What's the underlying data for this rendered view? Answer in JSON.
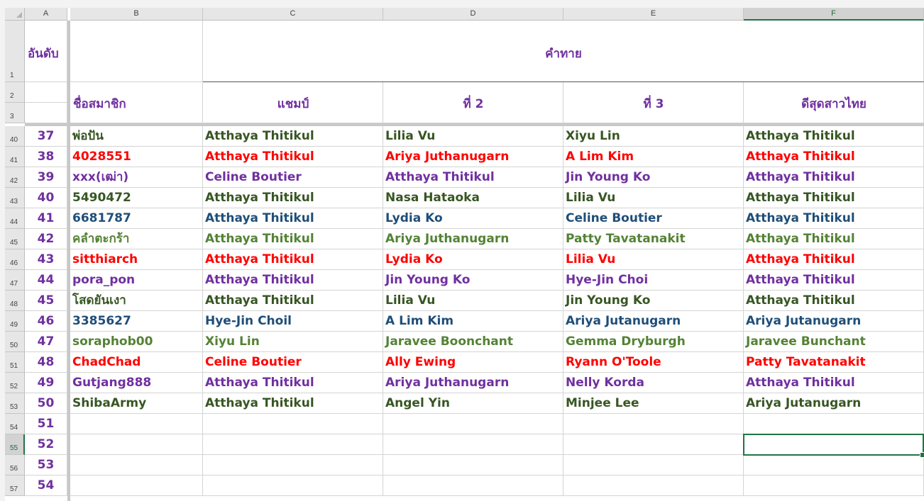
{
  "columns": [
    "A",
    "B",
    "C",
    "D",
    "E",
    "F"
  ],
  "selected_column": "F",
  "selected_cell": "F55",
  "header": {
    "rank": "อันดับ",
    "member": "ชื่อสมาชิก",
    "predictions": "คำทาย",
    "champion": "แชมป์",
    "second": "ที่ 2",
    "third": "ที่ 3",
    "best_thai": "ดีสุดสาวไทย"
  },
  "header_rows": [
    "1",
    "2",
    "3"
  ],
  "colors": {
    "purple": "#7030a0",
    "dark_green": "#375623",
    "red": "#ff0000",
    "blue": "#1f4e79",
    "green": "#548235",
    "selection": "#217346"
  },
  "rows": [
    {
      "row": "40",
      "rank": "37",
      "member": "พ่อปัน",
      "champion": "Atthaya Thitikul",
      "second": "Lilia Vu",
      "third": "Xiyu Lin",
      "best_thai": "Atthaya Thitikul",
      "color": "#375623"
    },
    {
      "row": "41",
      "rank": "38",
      "member": "4028551",
      "champion": "Atthaya Thitikul",
      "second": "Ariya Juthanugarn",
      "third": "A Lim Kim",
      "best_thai": "Atthaya Thitikul",
      "color": "#ff0000"
    },
    {
      "row": "42",
      "rank": "39",
      "member": "xxx(เฒ่า)",
      "champion": "Celine Boutier",
      "second": "Atthaya Thitikul",
      "third": "Jin Young Ko",
      "best_thai": "Atthaya Thitikul",
      "color": "#7030a0"
    },
    {
      "row": "43",
      "rank": "40",
      "member": "5490472",
      "champion": "Atthaya Thitikul",
      "second": "Nasa Hataoka",
      "third": "Lilia Vu",
      "best_thai": "Atthaya Thitikul",
      "color": "#375623"
    },
    {
      "row": "44",
      "rank": "41",
      "member": "6681787",
      "champion": "Atthaya Thitikul",
      "second": "Lydia Ko",
      "third": "Celine Boutier",
      "best_thai": "Atthaya Thitikul",
      "color": "#1f4e79"
    },
    {
      "row": "45",
      "rank": "42",
      "member": "คลำตะกร้า",
      "champion": "Atthaya Thitikul",
      "second": "Ariya Juthanugarn",
      "third": "Patty Tavatanakit",
      "best_thai": "Atthaya Thitikul",
      "color": "#548235"
    },
    {
      "row": "46",
      "rank": "43",
      "member": "sitthiarch",
      "champion": "Atthaya Thitikul",
      "second": "Lydia Ko",
      "third": "Lilia Vu",
      "best_thai": "Atthaya Thitikul",
      "color": "#ff0000"
    },
    {
      "row": "47",
      "rank": "44",
      "member": "pora_pon",
      "champion": "Atthaya Thitikul",
      "second": "Jin Young Ko",
      "third": "Hye-Jin Choi",
      "best_thai": "Atthaya Thitikul",
      "color": "#7030a0"
    },
    {
      "row": "48",
      "rank": "45",
      "member": "โสดยันเงา",
      "champion": "Atthaya Thitikul",
      "second": "Lilia Vu",
      "third": "Jin Young Ko",
      "best_thai": "Atthaya Thitikul",
      "color": "#375623"
    },
    {
      "row": "49",
      "rank": "46",
      "member": "3385627",
      "champion": "Hye-Jin Choil",
      "second": "A Lim Kim",
      "third": "Ariya Jutanugarn",
      "best_thai": "Ariya Jutanugarn",
      "color": "#1f4e79"
    },
    {
      "row": "50",
      "rank": "47",
      "member": "soraphob00",
      "champion": "Xiyu Lin",
      "second": "Jaravee Boonchant",
      "third": "Gemma Dryburgh",
      "best_thai": "Jaravee Bunchant",
      "color": "#548235"
    },
    {
      "row": "51",
      "rank": "48",
      "member": "ChadChad",
      "champion": "Celine Boutier",
      "second": "Ally Ewing",
      "third": "Ryann O'Toole",
      "best_thai": "Patty Tavatanakit",
      "color": "#ff0000"
    },
    {
      "row": "52",
      "rank": "49",
      "member": "Gutjang888",
      "champion": "Atthaya Thitikul",
      "second": "Ariya Juthanugarn",
      "third": "Nelly Korda",
      "best_thai": "Atthaya Thitikul",
      "color": "#7030a0"
    },
    {
      "row": "53",
      "rank": "50",
      "member": "ShibaArmy",
      "champion": "Atthaya Thitikul",
      "second": "Angel Yin",
      "third": "Minjee Lee",
      "best_thai": "Ariya Jutanugarn",
      "color": "#375623"
    },
    {
      "row": "54",
      "rank": "51",
      "member": "",
      "champion": "",
      "second": "",
      "third": "",
      "best_thai": "",
      "color": "#375623"
    },
    {
      "row": "55",
      "rank": "52",
      "member": "",
      "champion": "",
      "second": "",
      "third": "",
      "best_thai": "",
      "color": "#375623"
    },
    {
      "row": "56",
      "rank": "53",
      "member": "",
      "champion": "",
      "second": "",
      "third": "",
      "best_thai": "",
      "color": "#375623"
    },
    {
      "row": "57",
      "rank": "54",
      "member": "",
      "champion": "",
      "second": "",
      "third": "",
      "best_thai": "",
      "color": "#375623"
    }
  ]
}
